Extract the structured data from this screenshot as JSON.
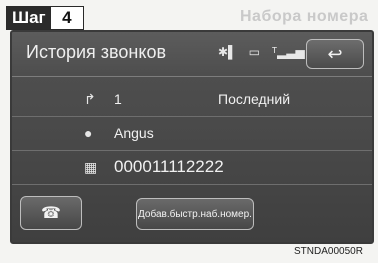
{
  "step": {
    "label": "Шаг",
    "number": "4"
  },
  "background_title": "Набора номера",
  "screen": {
    "title": "История звонков",
    "back_symbol": "↩",
    "status_icons": [
      "bluetooth-icon",
      "phone-battery-icon",
      "signal-icon"
    ],
    "rows": [
      {
        "icon": "outgoing-call-icon",
        "value": "1",
        "right": "Последний"
      },
      {
        "icon": "person-icon",
        "value": "Angus"
      },
      {
        "icon": "phone-number-icon",
        "value": "000011112222"
      }
    ],
    "add_button_label": "Добав.быстр.наб.номер."
  },
  "image_code": "STNDA00050R"
}
